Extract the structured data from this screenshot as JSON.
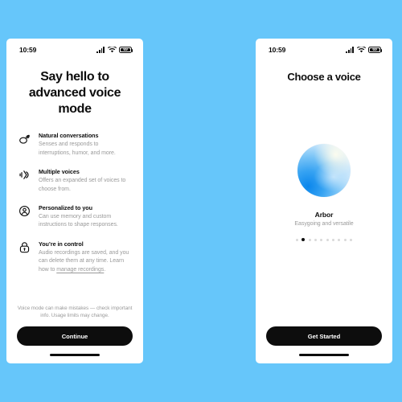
{
  "canvas": {
    "background_color": "#66c6fa"
  },
  "screens": [
    {
      "id": "advanced-voice-intro",
      "status_bar": {
        "time": "10:59",
        "battery_level": "69"
      },
      "headline": "Say hello to advanced voice mode",
      "features": [
        {
          "icon": "speech-bubbles-icon",
          "title": "Natural conversations",
          "desc": "Senses and responds to interruptions, humor, and more."
        },
        {
          "icon": "voice-waveform-icon",
          "title": "Multiple voices",
          "desc": "Offers an expanded set of voices to choose from."
        },
        {
          "icon": "person-circle-icon",
          "title": "Personalized to you",
          "desc": "Can use memory and custom instructions to shape responses."
        },
        {
          "icon": "lock-icon",
          "title": "You’re in control",
          "desc": "Audio recordings are saved, and you can delete them at any time. Learn how to ",
          "link": "manage recordings",
          "desc_tail": "."
        }
      ],
      "disclaimer": "Voice mode can make mistakes — check important info. Usage limits may change.",
      "primary_button": "Continue"
    },
    {
      "id": "choose-a-voice",
      "status_bar": {
        "time": "10:59",
        "battery_level": "69"
      },
      "title": "Choose a voice",
      "voice": {
        "name": "Arbor",
        "description": "Easygoing and versatile",
        "orb_colors": {
          "deep": "#0a86ec",
          "mid": "#7cc5f7",
          "light": "#eaf6fe",
          "highlight": "#fffdee"
        }
      },
      "carousel": {
        "total": 10,
        "active_index": 1
      },
      "primary_button": "Get Started"
    }
  ]
}
